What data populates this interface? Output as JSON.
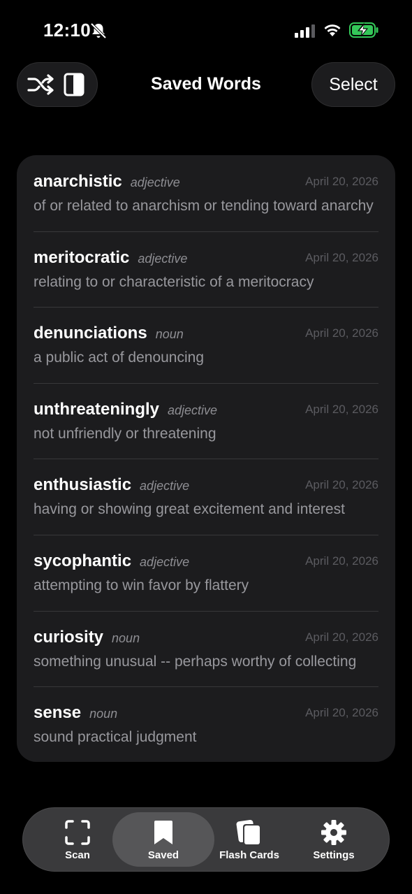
{
  "status": {
    "time": "12:10"
  },
  "nav": {
    "title": "Saved Words",
    "select_label": "Select"
  },
  "words": [
    {
      "word": "anarchistic",
      "pos": "adjective",
      "date": "April 20, 2026",
      "definition": "of or related to anarchism or tending toward anarchy"
    },
    {
      "word": "meritocratic",
      "pos": "adjective",
      "date": "April 20, 2026",
      "definition": "relating to or characteristic of a meritocracy"
    },
    {
      "word": "denunciations",
      "pos": "noun",
      "date": "April 20, 2026",
      "definition": "a public act of denouncing"
    },
    {
      "word": "unthreateningly",
      "pos": "adjective",
      "date": "April 20, 2026",
      "definition": "not unfriendly or threatening"
    },
    {
      "word": "enthusiastic",
      "pos": "adjective",
      "date": "April 20, 2026",
      "definition": "having or showing great excitement and interest"
    },
    {
      "word": "sycophantic",
      "pos": "adjective",
      "date": "April 20, 2026",
      "definition": "attempting to win favor by flattery"
    },
    {
      "word": "curiosity",
      "pos": "noun",
      "date": "April 20, 2026",
      "definition": "something unusual -- perhaps worthy of collecting"
    },
    {
      "word": "sense",
      "pos": "noun",
      "date": "April 20, 2026",
      "definition": "sound practical judgment"
    }
  ],
  "tabs": [
    {
      "label": "Scan",
      "icon": "scan-icon"
    },
    {
      "label": "Saved",
      "icon": "bookmark-icon",
      "active": true
    },
    {
      "label": "Flash Cards",
      "icon": "flash-cards-icon"
    },
    {
      "label": "Settings",
      "icon": "gear-icon"
    }
  ],
  "colors": {
    "background": "#000000",
    "card": "#1c1c1e",
    "battery_green": "#34c759"
  }
}
